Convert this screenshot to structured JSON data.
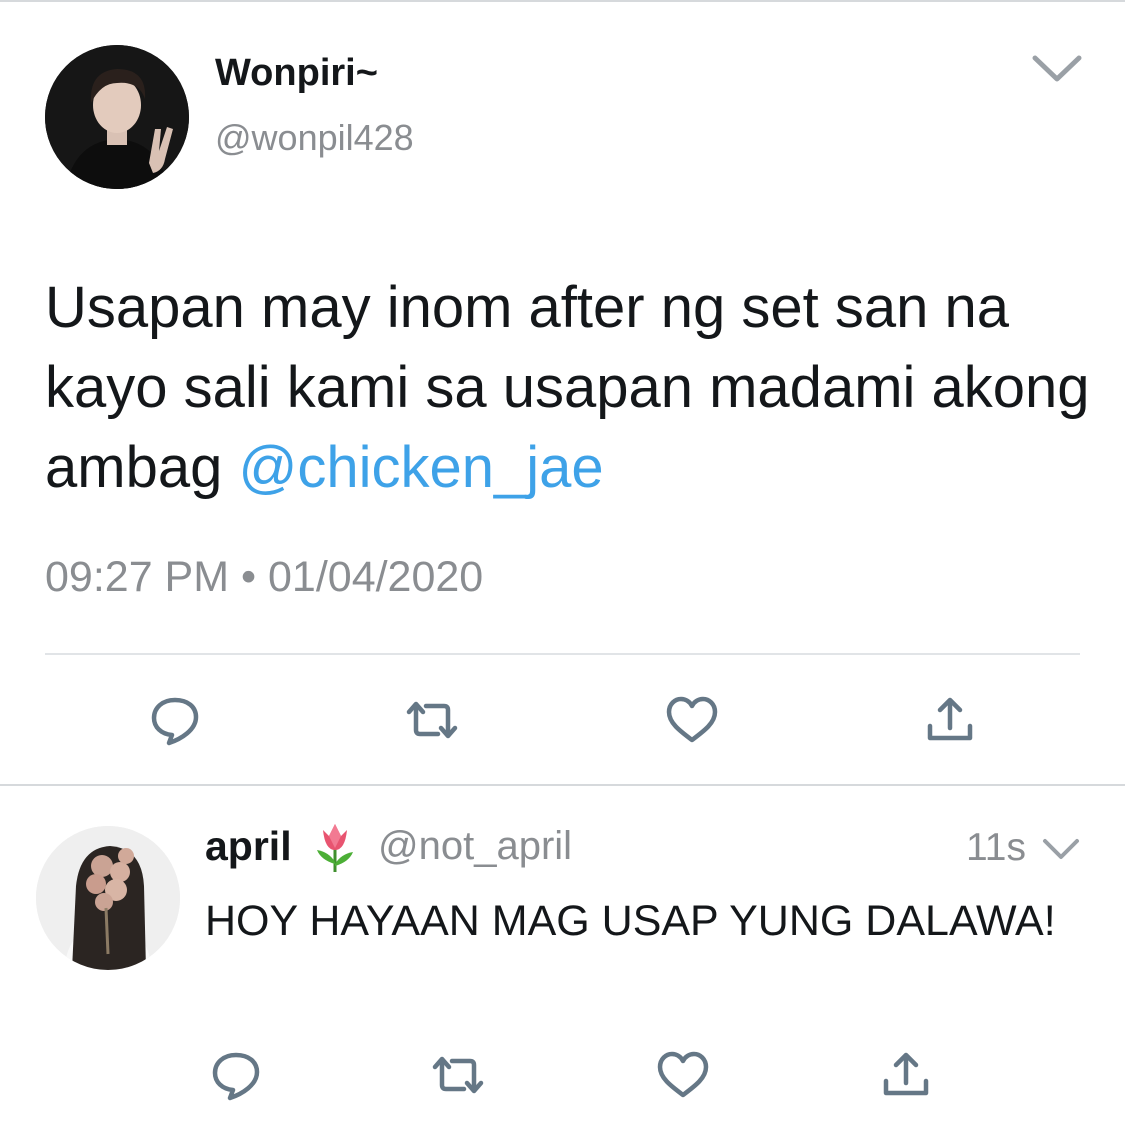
{
  "tweet": {
    "display_name": "Wonpiri~",
    "handle": "@wonpil428",
    "text": "Usapan may inom after ng set san na kayo sali kami sa usapan madami akong ambag ",
    "mention": "@chicken_jae",
    "timestamp": "09:27 PM • 01/04/2020",
    "avatar_icon": "user-photo-avatar",
    "menu_icon": "chevron-down-icon",
    "actions": [
      "reply-icon",
      "retweet-icon",
      "like-icon",
      "share-icon"
    ]
  },
  "reply": {
    "display_name": "april",
    "emoji": "🌷",
    "handle": "@not_april",
    "time": "11s",
    "text": "HOY HAYAAN MAG USAP YUNG DALAWA!",
    "avatar_icon": "user-photo-avatar",
    "menu_icon": "chevron-down-icon",
    "actions": [
      "reply-icon",
      "retweet-icon",
      "like-icon",
      "share-icon"
    ]
  },
  "colors": {
    "mention": "#3ea2e8",
    "secondary_text": "#8a8d91",
    "icon": "#657786",
    "divider": "#e1e4e7"
  }
}
